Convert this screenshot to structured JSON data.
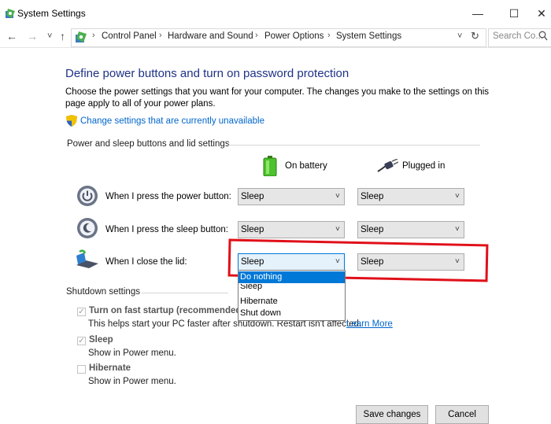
{
  "window": {
    "title": "System Settings",
    "minimize_glyph": "—",
    "maximize_glyph": "☐",
    "close_glyph": "✕"
  },
  "nav": {
    "back_glyph": "←",
    "forward_glyph": "→",
    "recent_glyph": "˅",
    "up_glyph": "↑",
    "refresh_glyph": "↻",
    "dropdown_glyph": "˅",
    "breadcrumb": [
      "Control Panel",
      "Hardware and Sound",
      "Power Options",
      "System Settings"
    ],
    "search_placeholder": "Search Co..."
  },
  "content": {
    "heading": "Define power buttons and turn on password protection",
    "intro_line1": "Choose the power settings that you want for your computer. The changes you make to the settings on this",
    "intro_line2": "page apply to all of your power plans.",
    "change_link": "Change settings that are currently unavailable",
    "section_buttons": "Power and sleep buttons and lid settings",
    "col_battery": "On battery",
    "col_plugged": "Plugged in",
    "rows": [
      {
        "label": "When I press the power button:",
        "battery": "Sleep",
        "plugged": "Sleep"
      },
      {
        "label": "When I press the sleep button:",
        "battery": "Sleep",
        "plugged": "Sleep"
      },
      {
        "label": "When I close the lid:",
        "battery": "Sleep",
        "plugged": "Sleep"
      }
    ],
    "dropdown_options": [
      "Do nothing",
      "Sleep",
      "Hibernate",
      "Shut down"
    ],
    "section_shutdown": "Shutdown settings",
    "fast_startup_label": "Turn on fast startup (recommended)",
    "fast_startup_desc": "This helps start your PC faster after shutdown. Restart isn't affected.",
    "learn_more": "Learn More",
    "sleep_label": "Sleep",
    "sleep_desc": "Show in Power menu.",
    "hibernate_label": "Hibernate",
    "hibernate_desc": "Show in Power menu.",
    "save_button": "Save changes",
    "cancel_button": "Cancel"
  },
  "colors": {
    "heading": "#1e3287",
    "link": "#0066cc",
    "highlight": "#e0101a",
    "dropdown_active": "#0078d7"
  }
}
